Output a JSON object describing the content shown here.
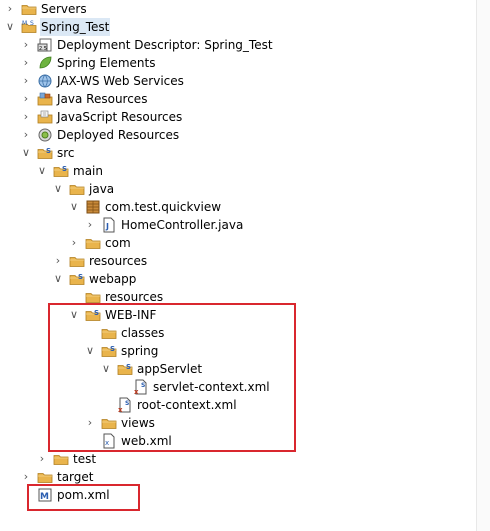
{
  "colors": {
    "highlight_border": "#d9272e",
    "folder": "#e9b44c",
    "selected_bg": "#dbe8f5"
  },
  "highlights": [
    "web-inf-group",
    "pom-xml"
  ],
  "tree": [
    {
      "label": "Servers",
      "toggle": "collapsed",
      "icon": "folder-icon"
    },
    {
      "label": "Spring_Test",
      "toggle": "expanded",
      "icon": "spring-project-icon",
      "selected": true
    },
    {
      "label": "Deployment Descriptor: Spring_Test",
      "toggle": "collapsed",
      "icon": "deployment-descriptor-icon"
    },
    {
      "label": "Spring Elements",
      "toggle": "collapsed",
      "icon": "spring-leaf-icon"
    },
    {
      "label": "JAX-WS Web Services",
      "toggle": "collapsed",
      "icon": "web-services-icon"
    },
    {
      "label": "Java Resources",
      "toggle": "collapsed",
      "icon": "java-resources-icon"
    },
    {
      "label": "JavaScript Resources",
      "toggle": "collapsed",
      "icon": "javascript-resources-icon"
    },
    {
      "label": "Deployed Resources",
      "toggle": "collapsed",
      "icon": "deployed-resources-icon"
    },
    {
      "label": "src",
      "toggle": "expanded",
      "icon": "spring-folder-icon"
    },
    {
      "label": "main",
      "toggle": "expanded",
      "icon": "spring-folder-icon"
    },
    {
      "label": "java",
      "toggle": "expanded",
      "icon": "folder-icon"
    },
    {
      "label": "com.test.quickview",
      "toggle": "expanded",
      "icon": "package-icon"
    },
    {
      "label": "HomeController.java",
      "toggle": "collapsed",
      "icon": "java-file-icon"
    },
    {
      "label": "com",
      "toggle": "collapsed",
      "icon": "folder-icon"
    },
    {
      "label": "resources",
      "toggle": "collapsed",
      "icon": "folder-icon"
    },
    {
      "label": "webapp",
      "toggle": "expanded",
      "icon": "spring-folder-icon"
    },
    {
      "label": "resources",
      "toggle": "none",
      "icon": "folder-icon"
    },
    {
      "label": "WEB-INF",
      "toggle": "expanded",
      "icon": "spring-folder-icon"
    },
    {
      "label": "classes",
      "toggle": "none",
      "icon": "folder-icon"
    },
    {
      "label": "spring",
      "toggle": "expanded",
      "icon": "spring-folder-icon"
    },
    {
      "label": "appServlet",
      "toggle": "expanded",
      "icon": "spring-folder-icon"
    },
    {
      "label": "servlet-context.xml",
      "toggle": "none",
      "icon": "spring-xml-icon"
    },
    {
      "label": "root-context.xml",
      "toggle": "none",
      "icon": "spring-xml-icon"
    },
    {
      "label": "views",
      "toggle": "collapsed",
      "icon": "folder-icon"
    },
    {
      "label": "web.xml",
      "toggle": "none",
      "icon": "xml-file-icon"
    },
    {
      "label": "test",
      "toggle": "collapsed",
      "icon": "folder-icon"
    },
    {
      "label": "target",
      "toggle": "collapsed",
      "icon": "folder-icon"
    },
    {
      "label": "pom.xml",
      "toggle": "none",
      "icon": "maven-pom-icon"
    }
  ]
}
